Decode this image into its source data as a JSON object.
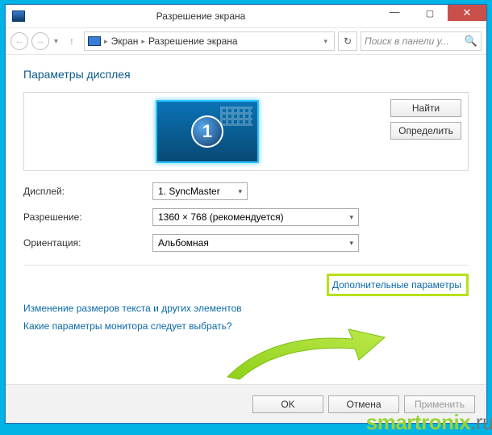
{
  "window": {
    "title": "Разрешение экрана",
    "controls": {
      "min": "min",
      "max": "max",
      "close": "close"
    }
  },
  "nav": {
    "crumbs": [
      "Экран",
      "Разрешение экрана"
    ],
    "search_placeholder": "Поиск в панели у...",
    "refresh": "refresh"
  },
  "page": {
    "header": "Параметры дисплея",
    "monitor_number": "1",
    "buttons": {
      "find": "Найти",
      "identify": "Определить"
    },
    "fields": {
      "display": {
        "label": "Дисплей:",
        "value": "1. SyncMaster"
      },
      "resolution": {
        "label": "Разрешение:",
        "value": "1360 × 768 (рекомендуется)"
      },
      "orientation": {
        "label": "Ориентация:",
        "value": "Альбомная"
      }
    },
    "links": {
      "advanced": "Дополнительные параметры",
      "text_size": "Изменение размеров текста и других элементов",
      "which_monitor": "Какие параметры монитора следует выбрать?"
    },
    "footer": {
      "ok": "OK",
      "cancel": "Отмена",
      "apply": "Применить"
    }
  },
  "watermark": {
    "brand": "smartronix",
    "tld": ".ru"
  }
}
